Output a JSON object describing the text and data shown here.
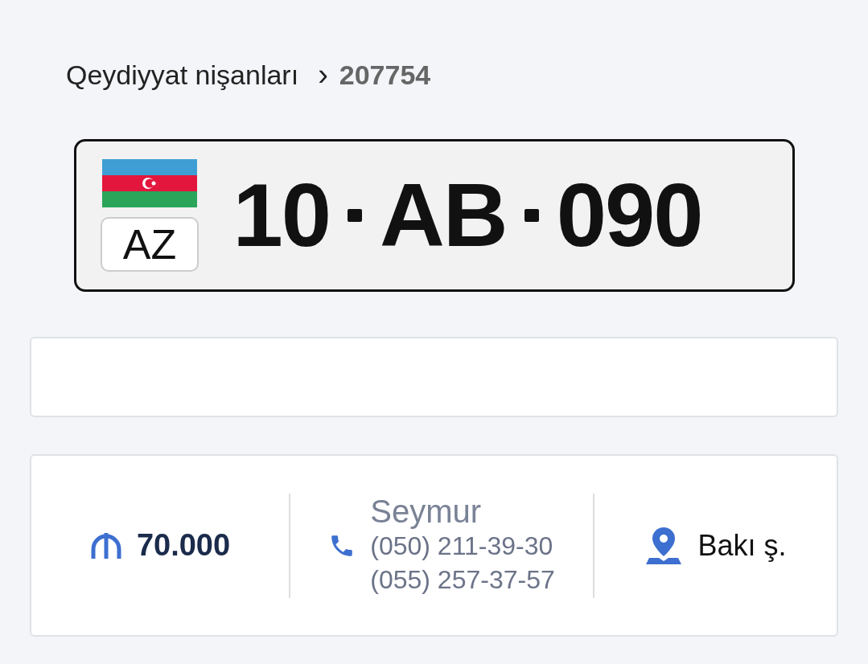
{
  "breadcrumb": {
    "section": "Qeydiyyat nişanları",
    "separator": "›",
    "id": "207754"
  },
  "plate": {
    "country": "AZ",
    "groups": [
      "10",
      "AB",
      "090"
    ]
  },
  "listing": {
    "price": "70.000",
    "seller": "Seymur",
    "phones": [
      "(050) 211-39-30",
      "(055) 257-37-57"
    ],
    "location": "Bakı ş."
  }
}
